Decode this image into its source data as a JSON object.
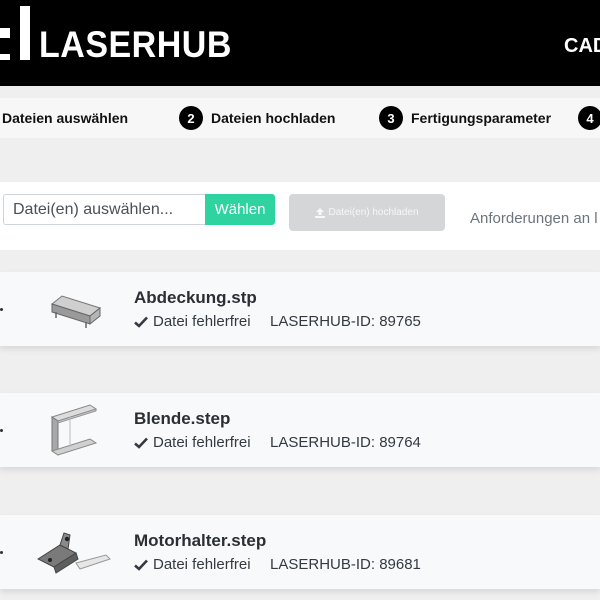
{
  "header": {
    "brand": "LASERHUB",
    "nav_right": "CAD"
  },
  "steps": [
    {
      "num": "1",
      "label": "Dateien auswählen"
    },
    {
      "num": "2",
      "label": "Dateien hochladen"
    },
    {
      "num": "3",
      "label": "Fertigungsparameter"
    },
    {
      "num": "4",
      "label": ""
    }
  ],
  "upload": {
    "input_value": "",
    "input_placeholder": "Datei(en) auswählen...",
    "choose_label": "Wählen",
    "upload_label": "Datei(en) hochladen",
    "requirements_link": "Anforderungen an l"
  },
  "files": [
    {
      "name": "Abdeckung.stp",
      "status": "Datei fehlerfrei",
      "id_text": "LASERHUB-ID: 89765"
    },
    {
      "name": "Blende.step",
      "status": "Datei fehlerfrei",
      "id_text": "LASERHUB-ID: 89764"
    },
    {
      "name": "Motorhalter.step",
      "status": "Datei fehlerfrei",
      "id_text": "LASERHUB-ID: 89681"
    }
  ],
  "colors": {
    "header_bg": "#000000",
    "accent_green": "#2fd39f",
    "disabled_button": "#d5d6d8"
  },
  "icons": {
    "status": "check-icon",
    "upload": "upload-icon",
    "thumbnails": [
      "part-cover-icon",
      "part-bracket-icon",
      "part-motor-mount-icon"
    ]
  }
}
